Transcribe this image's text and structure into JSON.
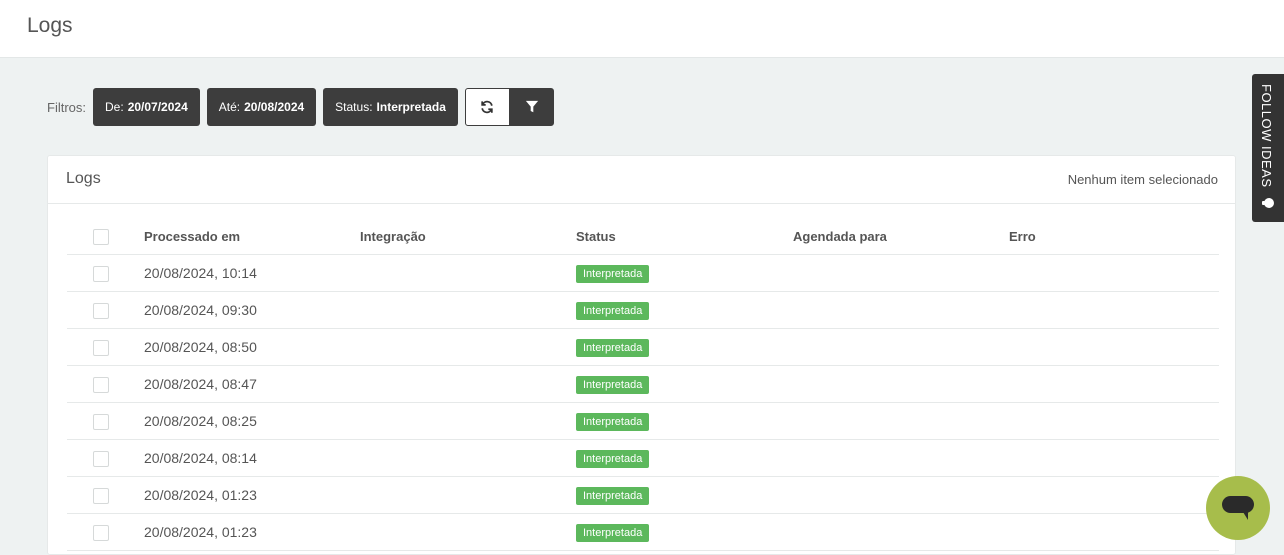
{
  "header": {
    "title": "Logs"
  },
  "filters": {
    "label": "Filtros:",
    "chips": [
      {
        "key": "De:",
        "value": "20/07/2024"
      },
      {
        "key": "Até:",
        "value": "20/08/2024"
      },
      {
        "key": "Status:",
        "value": "Interpretada"
      }
    ]
  },
  "panel": {
    "title": "Logs",
    "selection_status": "Nenhum item selecionado",
    "columns": [
      "Processado em",
      "Integração",
      "Status",
      "Agendada para",
      "Erro"
    ],
    "rows": [
      {
        "processed": "20/08/2024, 10:14",
        "integration": "",
        "status": "Interpretada",
        "scheduled": "",
        "error": ""
      },
      {
        "processed": "20/08/2024, 09:30",
        "integration": "",
        "status": "Interpretada",
        "scheduled": "",
        "error": ""
      },
      {
        "processed": "20/08/2024, 08:50",
        "integration": "",
        "status": "Interpretada",
        "scheduled": "",
        "error": ""
      },
      {
        "processed": "20/08/2024, 08:47",
        "integration": "",
        "status": "Interpretada",
        "scheduled": "",
        "error": ""
      },
      {
        "processed": "20/08/2024, 08:25",
        "integration": "",
        "status": "Interpretada",
        "scheduled": "",
        "error": ""
      },
      {
        "processed": "20/08/2024, 08:14",
        "integration": "",
        "status": "Interpretada",
        "scheduled": "",
        "error": ""
      },
      {
        "processed": "20/08/2024, 01:23",
        "integration": "",
        "status": "Interpretada",
        "scheduled": "",
        "error": ""
      },
      {
        "processed": "20/08/2024, 01:23",
        "integration": "",
        "status": "Interpretada",
        "scheduled": "",
        "error": ""
      }
    ]
  },
  "side_tab": {
    "label": "FOLLOW IDEAS",
    "icon": "lightbulb-icon"
  },
  "chat": {
    "icon": "chat-bubble-icon"
  },
  "colors": {
    "status_ok": "#5cb85c",
    "chip_bg": "#3d3d3d",
    "chat_bg": "#a7bd4b",
    "page_bg": "#eef2f2"
  }
}
